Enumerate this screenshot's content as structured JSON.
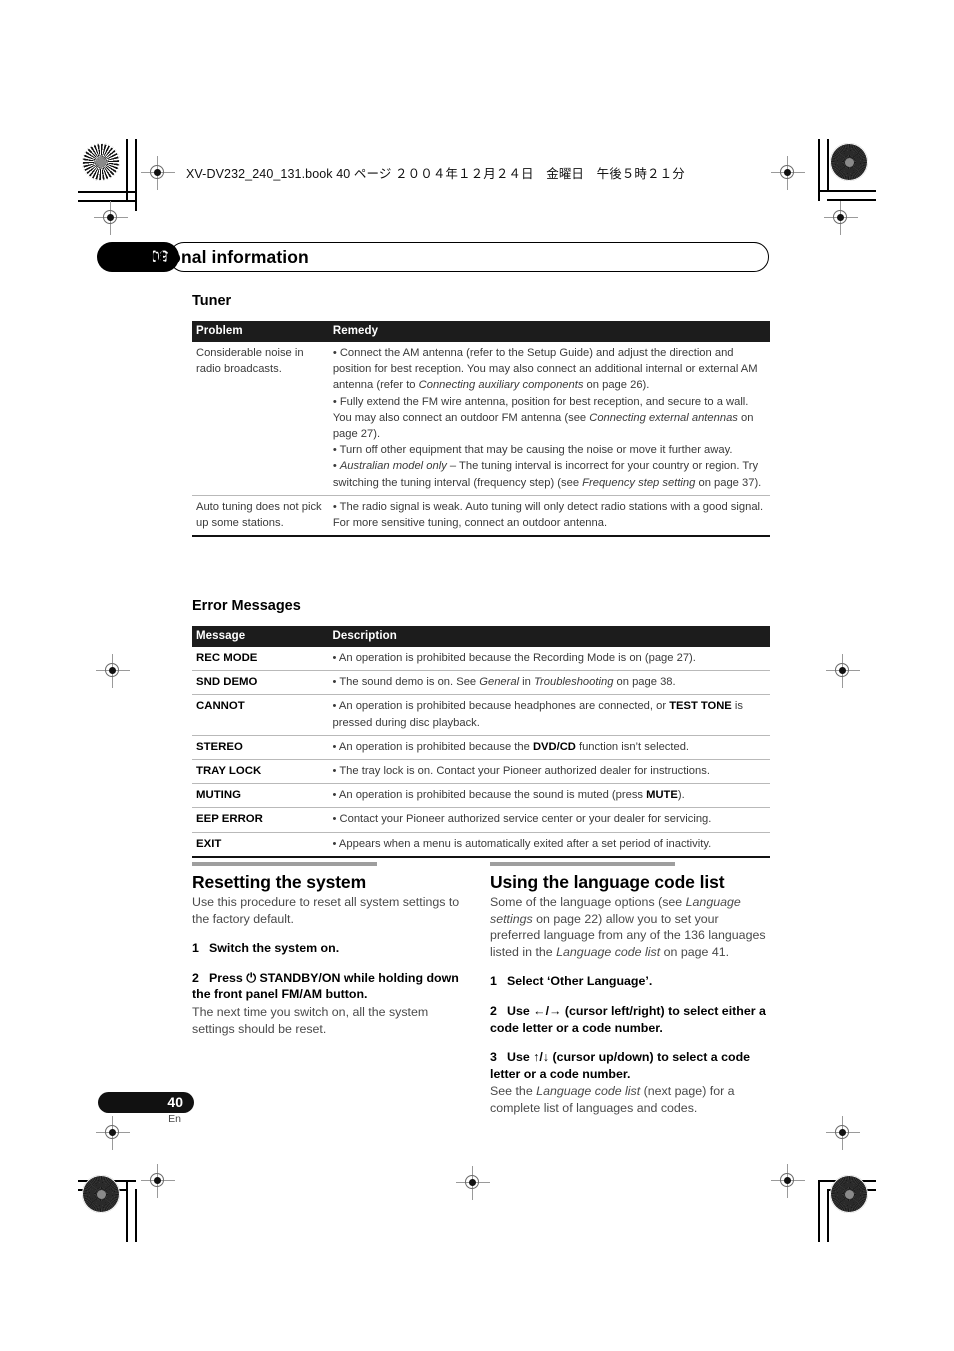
{
  "header": {
    "file_line": "XV-DV232_240_131.book  40 ページ  ２００４年１２月２４日　金曜日　午後５時２１分"
  },
  "chapter": {
    "number": "09",
    "title": "Additional information"
  },
  "tuner_section": {
    "heading": "Tuner",
    "columns": [
      "Problem",
      "Remedy"
    ],
    "rows": [
      {
        "problem": "Considerable noise in radio broadcasts.",
        "remedy_html": "• Connect the AM antenna (refer to the Setup Guide) and adjust the direction and position for best reception. You may also connect an additional internal or external AM antenna (refer to <i>Connecting auxiliary components</i> on page 26).<br>• Fully extend the FM wire antenna, position for best reception, and secure to a wall. You may also connect an outdoor FM antenna (see <i>Connecting external antennas</i> on page 27).<br>• Turn off other equipment that may be causing the noise or move it further away.<br>• <i>Australian model only</i> – The tuning interval is incorrect for your country or region. Try switching the tuning interval (frequency step) (see <i>Frequency step setting</i> on page 37)."
      },
      {
        "problem": "Auto tuning does not pick up some stations.",
        "remedy_html": "• The radio signal is weak. Auto tuning will only detect radio stations with a good signal. For more sensitive tuning, connect an outdoor antenna."
      }
    ]
  },
  "error_section": {
    "heading": "Error Messages",
    "columns": [
      "Message",
      "Description"
    ],
    "rows": [
      {
        "message": "REC MODE",
        "description_html": "• An operation is prohibited because the Recording Mode is on (page 27)."
      },
      {
        "message": "SND DEMO",
        "description_html": "• The sound demo is on. See <i>General</i> in <i>Troubleshooting</i> on page 38."
      },
      {
        "message": "CANNOT",
        "description_html": "• An operation is prohibited because headphones are connected, or <b>TEST TONE</b> is pressed during disc playback."
      },
      {
        "message": "STEREO",
        "description_html": "• An operation is prohibited because the <b>DVD/CD</b> function isn’t selected."
      },
      {
        "message": "TRAY LOCK",
        "description_html": "• The tray lock is on. Contact your Pioneer authorized dealer for instructions."
      },
      {
        "message": "MUTING",
        "description_html": "• An operation is prohibited because the sound is muted (press <b>MUTE</b>)."
      },
      {
        "message": "EEP ERROR",
        "description_html": "• Contact your Pioneer authorized service center or your dealer for servicing."
      },
      {
        "message": "EXIT",
        "description_html": "• Appears when a menu is automatically exited after a set period of inactivity."
      }
    ]
  },
  "left_column": {
    "title": "Resetting the system",
    "intro": "Use this procedure to reset all system settings to the factory default.",
    "steps": [
      {
        "number": "1",
        "text": "Switch the system on.",
        "note": ""
      },
      {
        "number": "2",
        "text": "Press ⏻ STANDBY/ON while holding down the front panel FM/AM button.",
        "note": "The next time you switch on, all the system settings should be reset."
      }
    ]
  },
  "right_column": {
    "title": "Using the language code list",
    "intro_html": "Some of the language options (see <i>Language settings</i> on page 22) allow you to set your preferred language from any of the 136 languages listed in the <i>Language code list</i> on page 41.",
    "steps": [
      {
        "number": "1",
        "text": "Select ‘Other Language’.",
        "note_html": ""
      },
      {
        "number": "2",
        "text": "Use ←/→ (cursor left/right) to select either a code letter or a code number.",
        "note_html": ""
      },
      {
        "number": "3",
        "text": "Use ↑/↓ (cursor up/down) to select a code letter or a code number.",
        "note_html": "See the <i>Language code list</i> (next page) for a complete list of languages and codes."
      }
    ]
  },
  "footer": {
    "page_number": "40",
    "language_code": "En"
  }
}
